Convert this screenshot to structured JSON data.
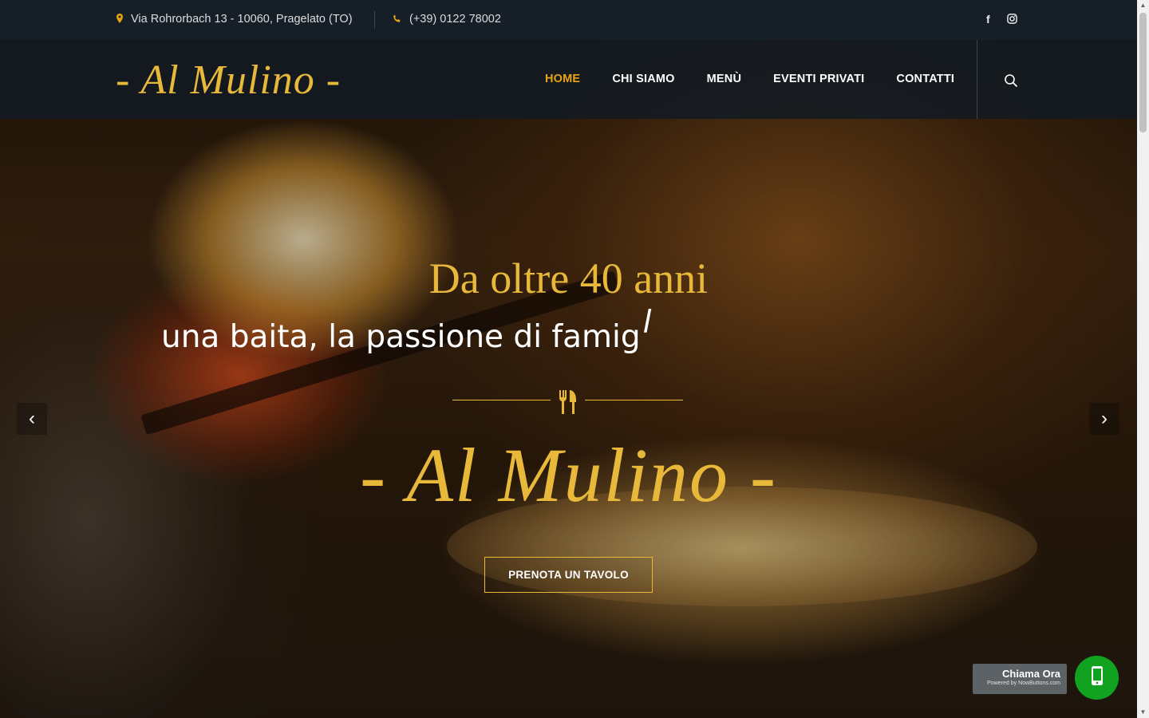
{
  "topbar": {
    "address": "Via Rohrorbach 13 - 10060, Pragelato (TO)",
    "phone": "(+39) 0122 78002",
    "icons": [
      "map-marker-icon",
      "phone-icon",
      "facebook-icon",
      "instagram-icon"
    ],
    "social": {
      "facebook": "f"
    }
  },
  "navbar": {
    "logo": "- Al Mulino -",
    "items": [
      {
        "label": "HOME",
        "active": true
      },
      {
        "label": "CHI SIAMO",
        "active": false
      },
      {
        "label": "MENÙ",
        "active": false
      },
      {
        "label": "EVENTI PRIVATI",
        "active": false
      },
      {
        "label": "CONTATTI",
        "active": false
      }
    ],
    "icons": [
      "search-icon"
    ]
  },
  "hero": {
    "title": "Da oltre 40 anni",
    "subtitle": "una baita, la passione di famig",
    "caret": "l",
    "logo": "- Al Mulino -",
    "cta": "PRENOTA UN TAVOLO",
    "icons": [
      "cutlery-icon",
      "chevron-left-icon",
      "chevron-right-icon"
    ],
    "prev_arrow": "‹",
    "next_arrow": "›"
  },
  "call_widget": {
    "label": "Chiama Ora",
    "powered": "Powered by NowButtons.com",
    "icons": [
      "mobile-phone-icon"
    ]
  },
  "colors": {
    "accent": "#e7a514",
    "gold": "#e7b83a",
    "topbar_bg": "#161e27",
    "call_green": "#11a31f"
  }
}
